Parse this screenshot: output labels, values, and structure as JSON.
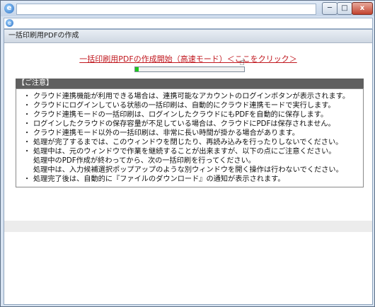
{
  "window": {
    "min_label": "─",
    "max_label": "□",
    "close_label": "x"
  },
  "section": {
    "title": "一括印刷用PDFの作成"
  },
  "start_link": "一括印刷用PDFの作成開始（高速モード）＜ここをクリック＞",
  "progress": {
    "fraction": 0.03,
    "color": "#1dc81d"
  },
  "notice": {
    "title": "【ご注意】",
    "items": [
      "クラウド連携機能が利用できる場合は、連携可能なアカウントのログインボタンが表示されます。",
      "クラウドにログインしている状態の一括印刷は、自動的にクラウド連携モードで実行します。",
      "クラウド連携モードの一括印刷は、ログインしたクラウドにもPDFを自動的に保存します。",
      "ログインしたクラウドの保存容量が不足している場合は、クラウドにPDFは保存されません。",
      "クラウド連携モード以外の一括印刷は、非常に長い時間が掛かる場合があります。",
      "処理が完了するまでは、このウィンドウを閉じたり、再読み込みを行ったりしないでください。",
      "処理中は、元のウィンドウで作業を継続することが出来ますが、以下の点にご注意ください。\n処理中のPDF作成が終わってから、次の一括印刷を行ってください。\n処理中は、入力候補選択ポップアップのような別ウィンドウを開く操作は行わないでください。",
      "処理完了後は、自動的に『ファイルのダウンロード』の通知が表示されます。"
    ]
  },
  "colors": {
    "link": "#c0171e",
    "notice_header_bg": "#5f5f5f"
  }
}
